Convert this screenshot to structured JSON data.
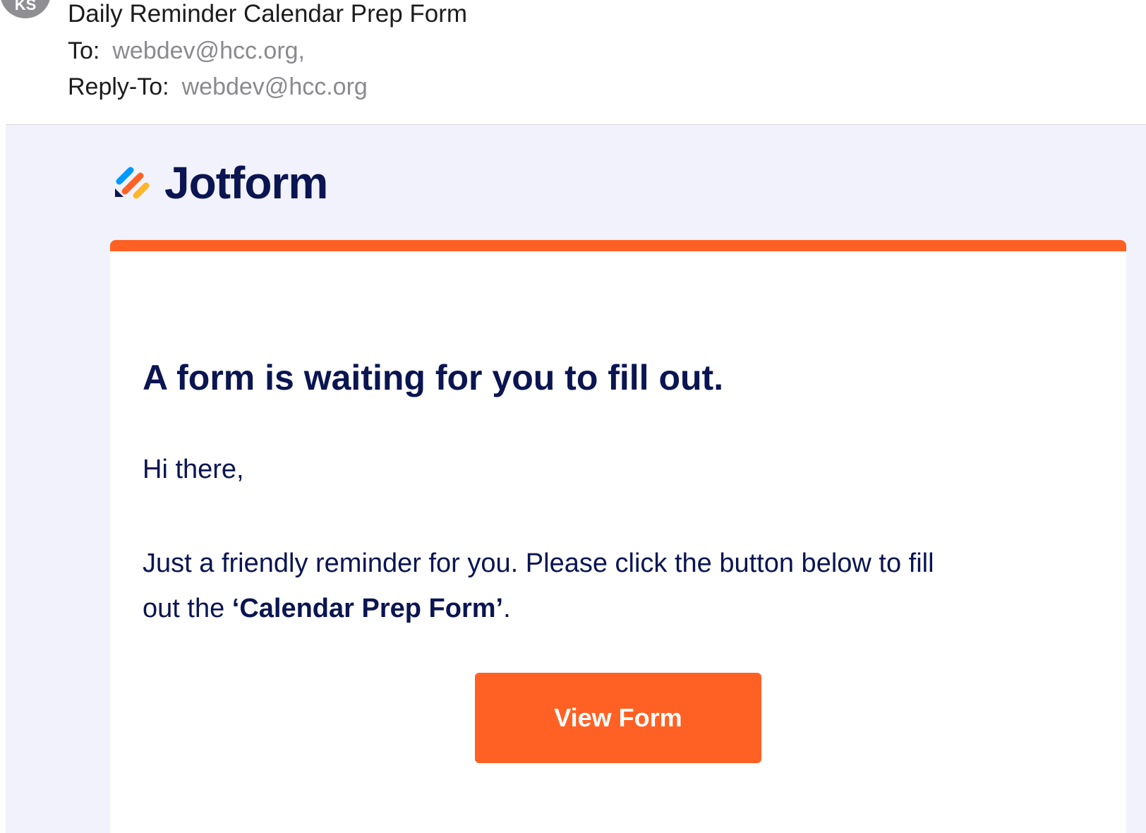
{
  "mail": {
    "avatar_initials": "KS",
    "subject": "Daily Reminder Calendar Prep Form",
    "to_label": "To:",
    "to_value": "webdev@hcc.org,",
    "reply_to_label": "Reply-To:",
    "reply_to_value": "webdev@hcc.org"
  },
  "email": {
    "brand_name": "Jotform",
    "brand_icon": "jotform-logo-icon",
    "accent_color": "#ff6124",
    "text_color": "#0a1551",
    "headline": "A form is waiting for you to fill out.",
    "greeting": "Hi there,",
    "message_before": "Just a friendly reminder for you. Please click the button below to fill out the ",
    "form_name": "‘Calendar Prep Form’",
    "message_after": ".",
    "button_label": "View Form"
  }
}
